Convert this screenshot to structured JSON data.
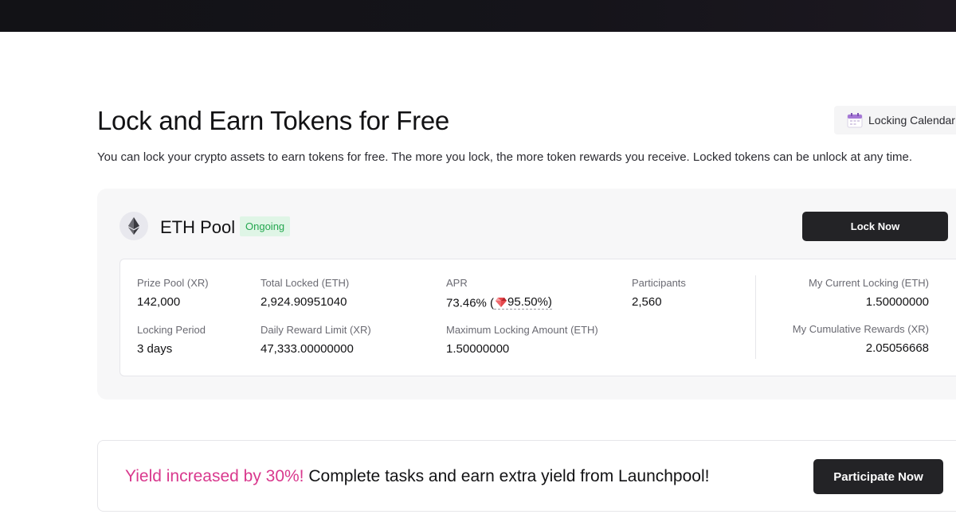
{
  "header": {
    "title": "Lock and Earn Tokens for Free",
    "subtitle": "You can lock your crypto assets to earn tokens for free. The more you lock, the more token rewards you receive. Locked tokens can be unlock at any time.",
    "calendar_label": "Locking Calendar"
  },
  "pool": {
    "name": "ETH Pool",
    "status": "Ongoing",
    "lock_button": "Lock Now",
    "prize_pool_label": "Prize Pool (XR)",
    "prize_pool_value": "142,000",
    "locking_period_label": "Locking Period",
    "locking_period_value": "3 days",
    "total_locked_label": "Total Locked (ETH)",
    "total_locked_value": "2,924.90951040",
    "daily_limit_label": "Daily Reward Limit (XR)",
    "daily_limit_value": "47,333.00000000",
    "apr_label": "APR",
    "apr_value": "73.46% (",
    "apr_boosted": "95.50%)",
    "max_lock_label": "Maximum Locking Amount (ETH)",
    "max_lock_value": "1.50000000",
    "participants_label": "Participants",
    "participants_value": "2,560",
    "my_locking_label": "My Current Locking (ETH)",
    "my_locking_value": "1.50000000",
    "my_rewards_label": "My Cumulative Rewards (XR)",
    "my_rewards_value": "2.05056668"
  },
  "promo": {
    "highlight": "Yield increased by 30%!",
    "text": " Complete tasks and earn extra yield from Launchpool!",
    "button": "Participate Now"
  },
  "icons": {
    "calendar": "calendar-icon",
    "eth": "ethereum-icon",
    "boost": "gem-icon"
  },
  "colors": {
    "accent_pink": "#d9398e",
    "status_green": "#25a750",
    "status_green_bg": "#dff5e6",
    "button_dark": "#232326"
  }
}
